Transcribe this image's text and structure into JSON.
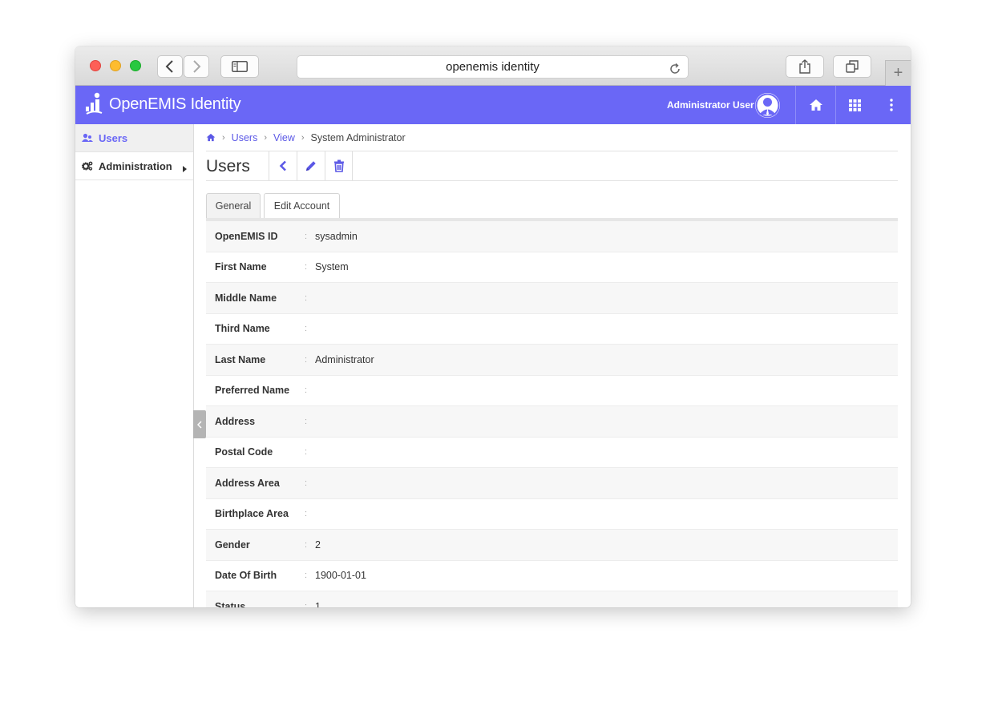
{
  "browser": {
    "url_text": "openemis identity",
    "new_tab": "+"
  },
  "app": {
    "brand": "OpenEMIS Identity",
    "user_name": "Administrator User",
    "accent_color": "#6a67f6"
  },
  "sidebar": {
    "items": [
      {
        "label": "Users",
        "icon": "users-icon",
        "active": true
      },
      {
        "label": "Administration",
        "icon": "cogs-icon",
        "active": false
      }
    ]
  },
  "breadcrumb": {
    "items": [
      "Users",
      "View"
    ],
    "current": "System Administrator"
  },
  "page": {
    "title": "Users"
  },
  "tabs": [
    "General",
    "Edit Account"
  ],
  "fields": [
    {
      "label": "OpenEMIS ID",
      "colon": ":",
      "value": "sysadmin"
    },
    {
      "label": "First Name",
      "colon": ":",
      "value": "System"
    },
    {
      "label": "Middle Name",
      "colon": ":",
      "value": ""
    },
    {
      "label": "Third Name",
      "colon": ":",
      "value": ""
    },
    {
      "label": "Last Name",
      "colon": ":",
      "value": "Administrator"
    },
    {
      "label": "Preferred Name",
      "colon": ":",
      "value": ""
    },
    {
      "label": "Address",
      "colon": ":",
      "value": ""
    },
    {
      "label": "Postal Code",
      "colon": ":",
      "value": ""
    },
    {
      "label": "Address Area",
      "colon": ":",
      "value": ""
    },
    {
      "label": "Birthplace Area",
      "colon": ":",
      "value": ""
    },
    {
      "label": "Gender",
      "colon": ":",
      "value": "2"
    },
    {
      "label": "Date Of Birth",
      "colon": ":",
      "value": "1900-01-01"
    },
    {
      "label": "Status",
      "colon": ":",
      "value": "1"
    }
  ]
}
